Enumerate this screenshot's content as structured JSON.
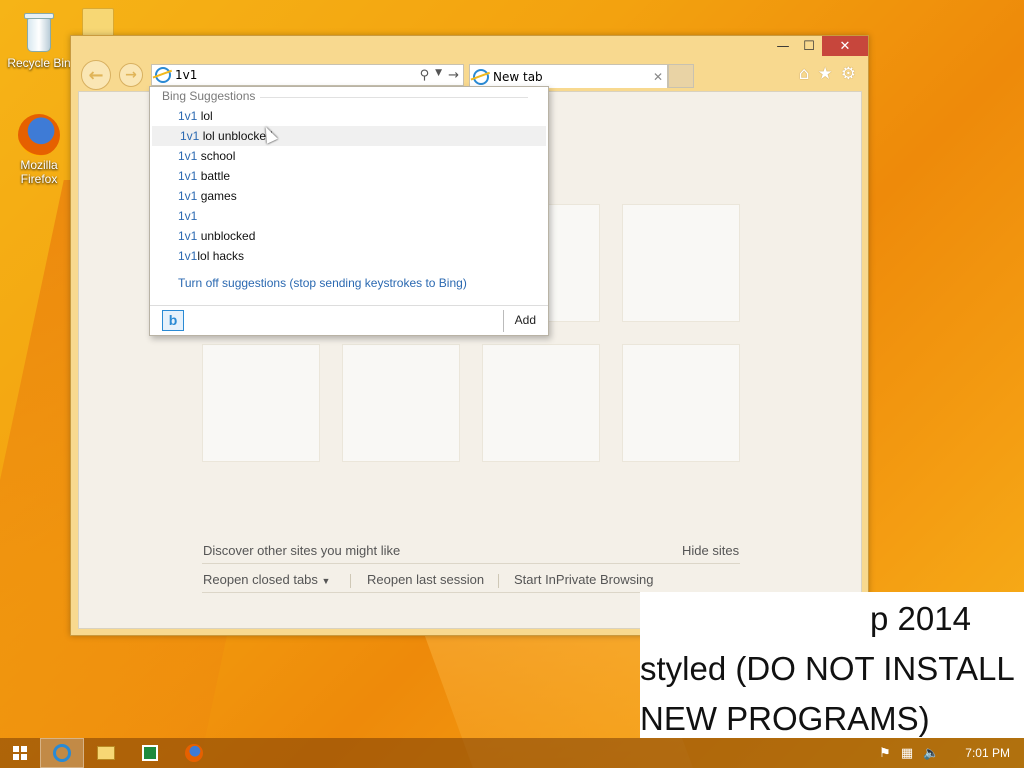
{
  "desktop": {
    "icons": [
      {
        "label": "Recycle Bin"
      },
      {
        "label": "Mozilla Firefox"
      }
    ]
  },
  "browser": {
    "address_value": "1v1",
    "tab_title": "New tab",
    "window_buttons": {
      "minimize": "—",
      "maximize": "☐",
      "close": "✕"
    }
  },
  "suggestions": {
    "header": "Bing Suggestions",
    "items": [
      {
        "query": "1v1",
        "rest": " lol"
      },
      {
        "query": "1v1",
        "rest": " lol unblocked"
      },
      {
        "query": "1v1",
        "rest": " school"
      },
      {
        "query": "1v1",
        "rest": " battle"
      },
      {
        "query": "1v1",
        "rest": " games"
      },
      {
        "query": "1v1",
        "rest": ""
      },
      {
        "query": "1v1",
        "rest": " unblocked"
      },
      {
        "query": "1v1",
        "rest": "lol hacks"
      }
    ],
    "turn_off": "Turn off suggestions (stop sending keystrokes to Bing)",
    "add_label": "Add"
  },
  "new_tab_page": {
    "discover": "Discover other sites you might like",
    "hide_sites": "Hide sites",
    "reopen_closed": "Reopen closed tabs",
    "reopen_last": "Reopen last session",
    "inprivate": "Start InPrivate Browsing"
  },
  "caption": {
    "line1": "p 2014",
    "line2": "styled (DO NOT INSTALL",
    "line3": "NEW PROGRAMS)"
  },
  "taskbar": {
    "clock": "7:01 PM"
  },
  "colors": {
    "accent": "#2b69b1",
    "close_red": "#c7463c"
  }
}
